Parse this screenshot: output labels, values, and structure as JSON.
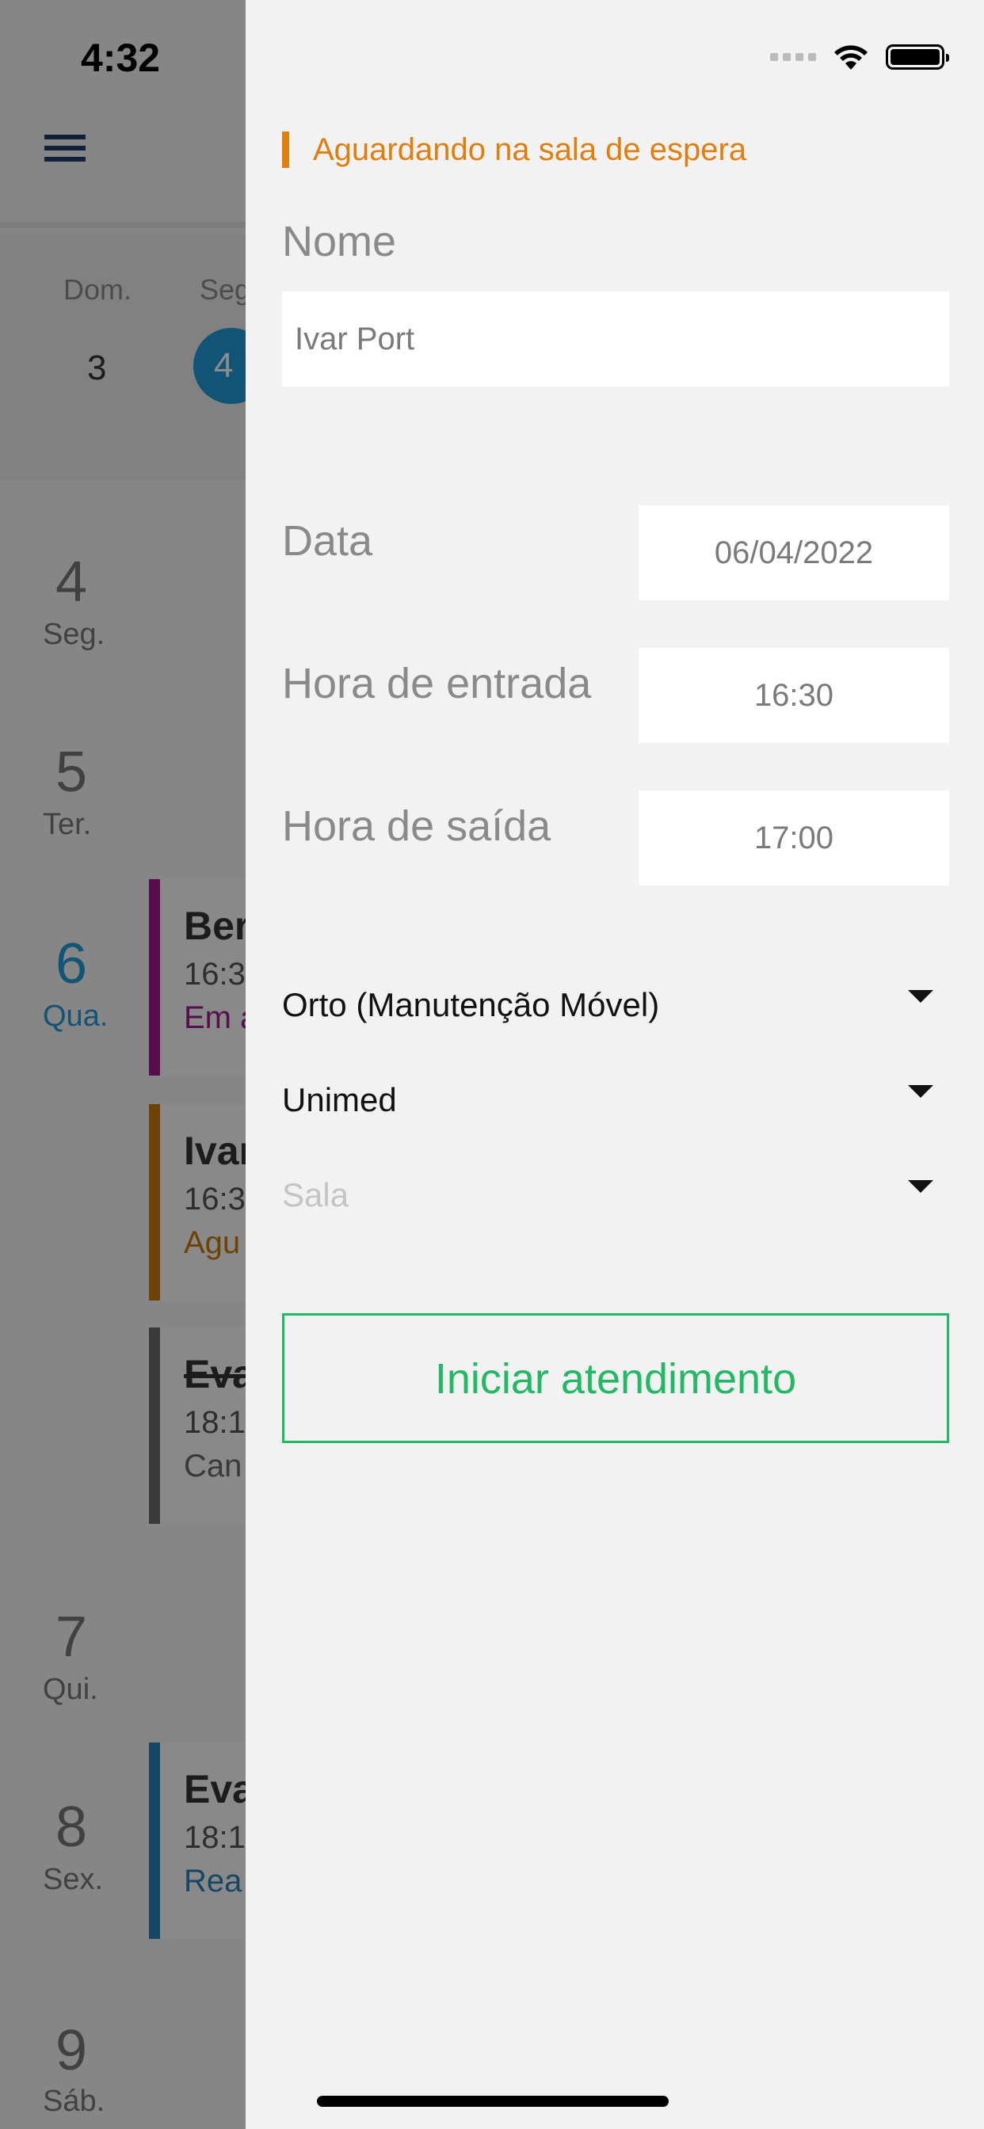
{
  "status_bar": {
    "time": "4:32"
  },
  "calendar": {
    "weekdays": [
      {
        "abbr": "Dom.",
        "num": "3"
      },
      {
        "abbr": "Seg",
        "num": "4"
      }
    ],
    "days": [
      {
        "num": "4",
        "label": "Seg."
      },
      {
        "num": "5",
        "label": "Ter."
      },
      {
        "num": "6",
        "label": "Qua."
      },
      {
        "num": "7",
        "label": "Qui."
      },
      {
        "num": "8",
        "label": "Sex."
      },
      {
        "num": "9",
        "label": "Sáb."
      }
    ],
    "events": [
      {
        "title": "Ber",
        "hour": "16:3",
        "status": "Em a",
        "color": "#a01a8c"
      },
      {
        "title": "Ivar",
        "hour": "16:3",
        "status": "Agu",
        "color": "#c7780e"
      },
      {
        "title": "Eva",
        "hour": "18:1",
        "status": "Can",
        "color": "#6b6b6b"
      },
      {
        "title": "Eva",
        "hour": "18:1",
        "status": "Rea",
        "color": "#2b7fb8"
      }
    ]
  },
  "panel": {
    "status_label": "Aguardando na sala de espera",
    "status_color": "#e07f0f",
    "name_label": "Nome",
    "name_value": "Ivar Port",
    "date_label": "Data",
    "date_value": "06/04/2022",
    "entry_label": "Hora de entrada",
    "entry_value": "16:30",
    "exit_label": "Hora de saída",
    "exit_value": "17:00",
    "procedure_value": "Orto (Manutenção Móvel)",
    "insurance_value": "Unimed",
    "room_placeholder": "Sala",
    "start_button": "Iniciar atendimento",
    "button_color": "#23b865"
  }
}
